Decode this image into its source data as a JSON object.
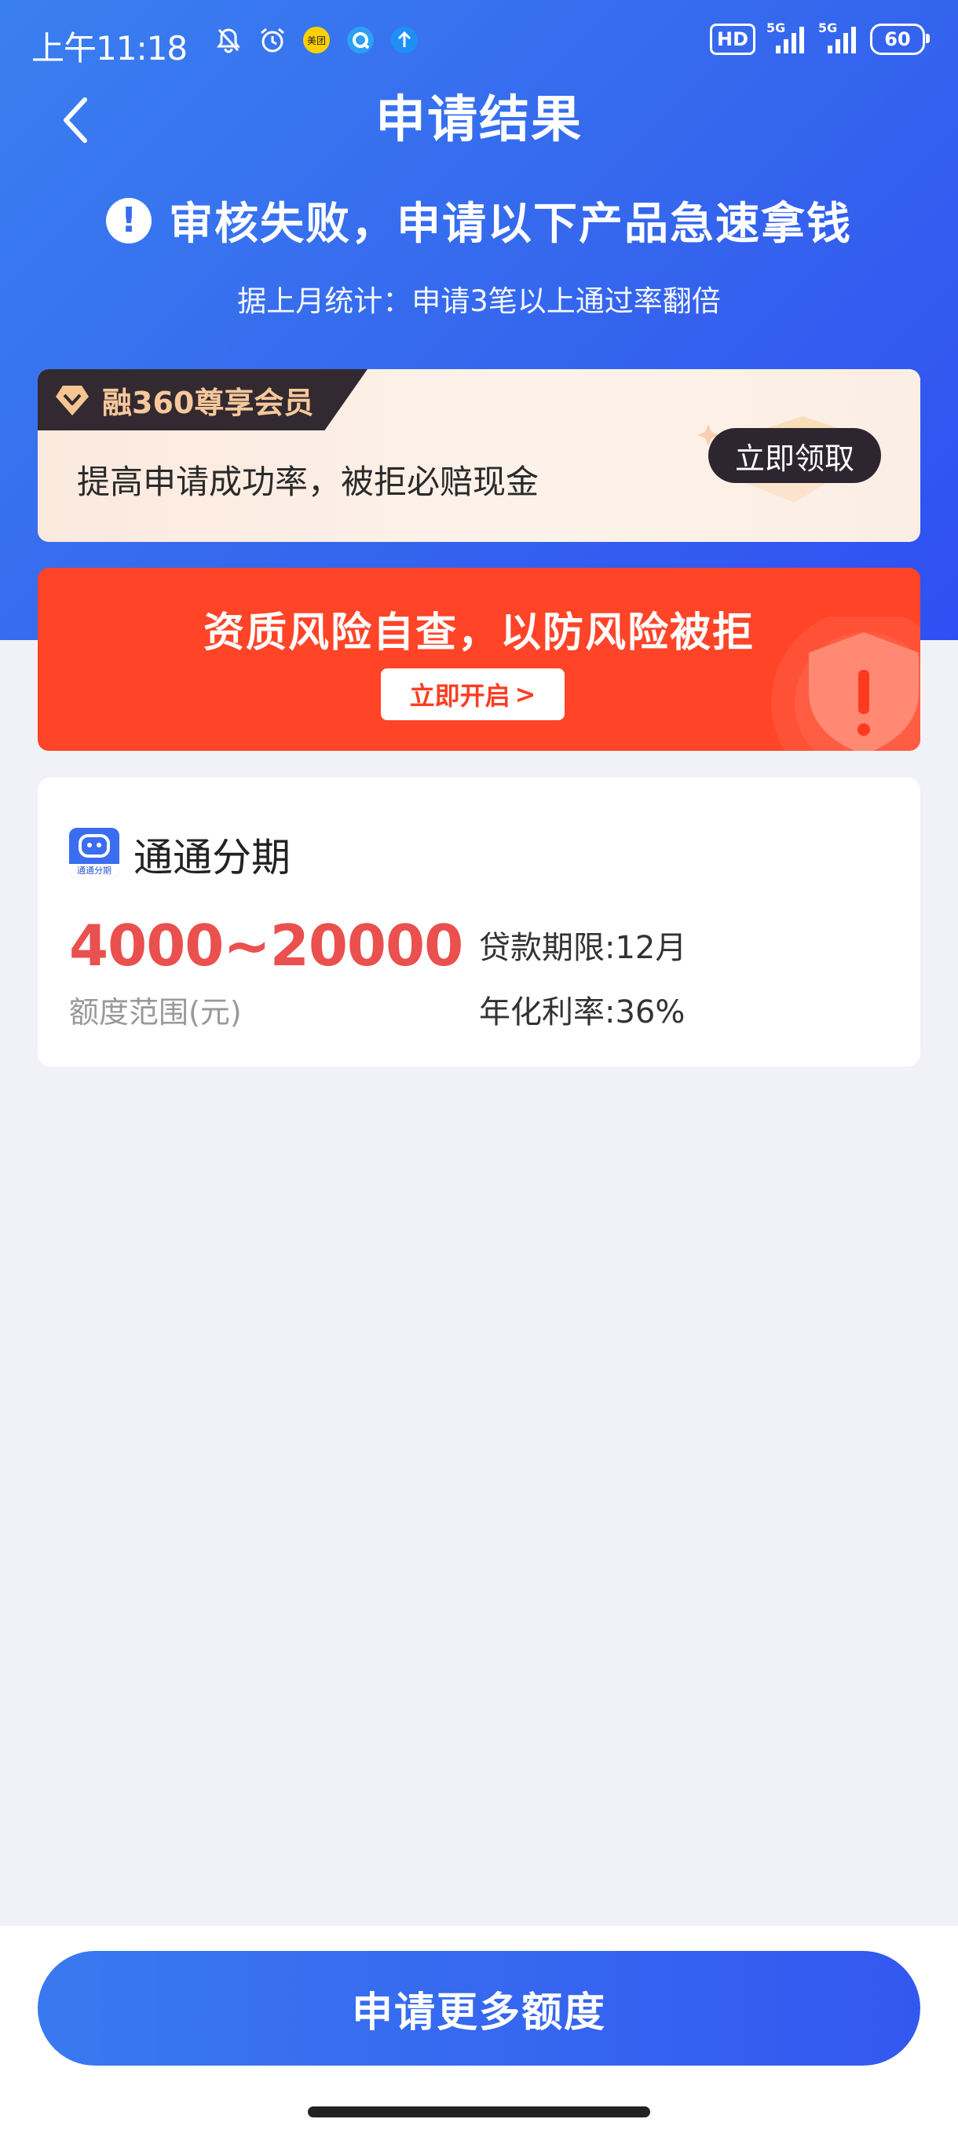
{
  "status_bar": {
    "time": "上午11:18",
    "left_icons": [
      "mute-bell-icon",
      "alarm-icon",
      "meituan-app-icon",
      "browser-app-icon",
      "upload-arrow-icon"
    ],
    "meituan_label": "美团",
    "hd_label": "HD",
    "signal_label_1": "5G",
    "signal_label_2": "5G",
    "battery": "60"
  },
  "nav": {
    "title": "申请结果"
  },
  "result": {
    "message": "审核失败，申请以下产品急速拿钱",
    "stat": "据上月统计：申请3笔以上通过率翻倍"
  },
  "member": {
    "tag": "融360尊享会员",
    "desc": "提高申请成功率，被拒必赔现金",
    "button": "立即领取"
  },
  "risk": {
    "title": "资质风险自查，以防风险被拒",
    "button": "立即开启",
    "button_arrow": ">"
  },
  "product": {
    "name": "通通分期",
    "logo_label": "通通分期",
    "amount_range": "4000~20000",
    "amount_label": "额度范围(元)",
    "term": "贷款期限:12月",
    "rate": "年化利率:36%"
  },
  "bottom": {
    "apply_button": "申请更多额度"
  },
  "colors": {
    "brand_blue": "#3566ee",
    "risk_red": "#ff4428",
    "amount_red": "#e9504e"
  }
}
